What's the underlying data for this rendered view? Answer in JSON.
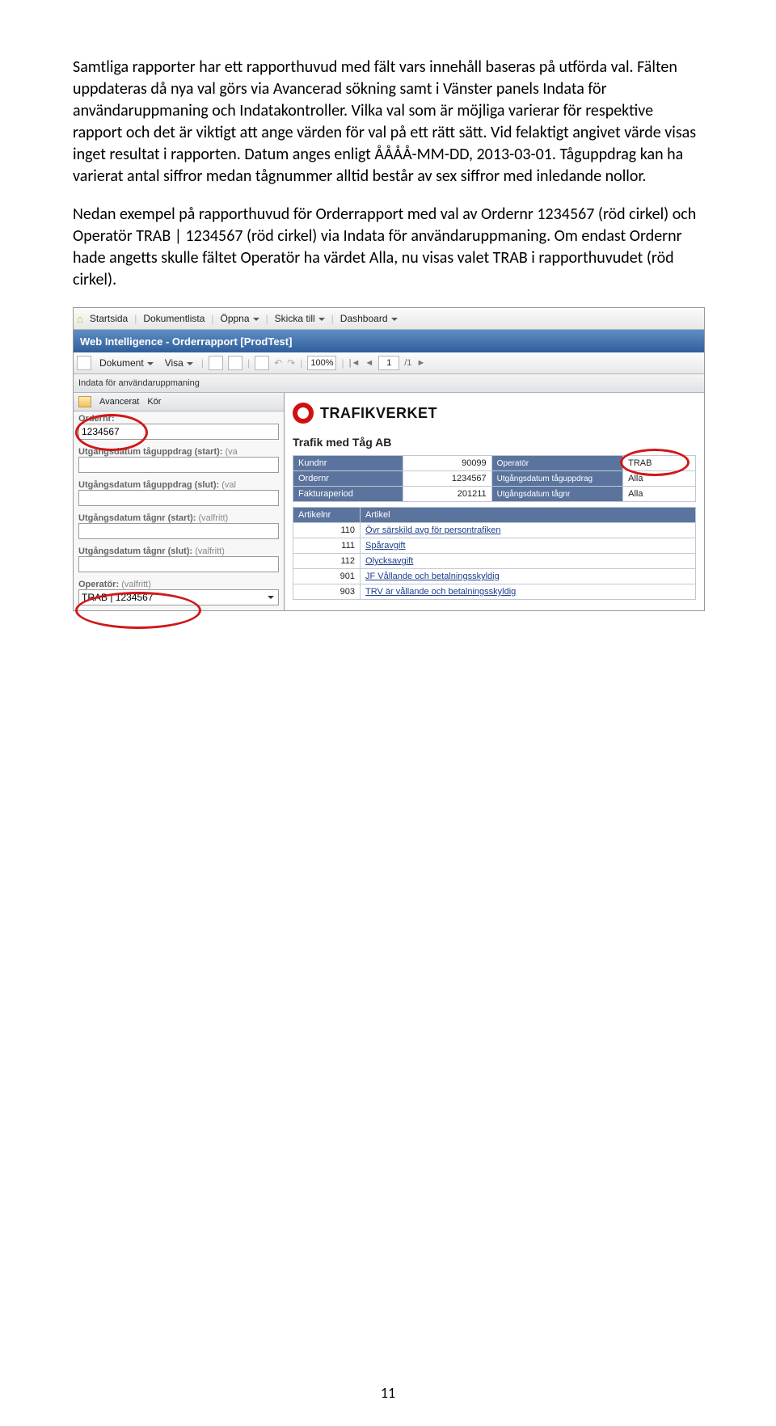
{
  "document": {
    "para1": "Samtliga rapporter har ett rapporthuvud med fält vars innehåll baseras på utförda val. Fälten uppdateras då nya val görs via Avancerad sökning samt i Vänster panels Indata för användaruppmaning och Indatakontroller. Vilka val som är möjliga varierar för respektive rapport och det är viktigt att ange värden för val på ett rätt sätt. Vid felaktigt angivet värde visas inget resultat i rapporten. Datum anges enligt ÅÅÅÅ-MM-DD, 2013-03-01. Tåguppdrag kan ha varierat antal siffror medan tågnummer alltid består av sex siffror med inledande nollor.",
    "para2": "Nedan exempel på rapporthuvud för Orderrapport med val av Ordernr 1234567 (röd cirkel) och Operatör TRAB | 1234567 (röd cirkel) via Indata för användaruppmaning. Om endast Ordernr hade angetts skulle fältet Operatör ha värdet Alla, nu visas valet TRAB i rapporthuvudet (röd cirkel).",
    "pageNumber": "11"
  },
  "app": {
    "tabs": {
      "start": "Startsida",
      "doclist": "Dokumentlista",
      "open": "Öppna",
      "send": "Skicka till",
      "dash": "Dashboard"
    },
    "title": "Web Intelligence - Orderrapport [ProdTest]",
    "toolbar": {
      "doc": "Dokument",
      "visa": "Visa",
      "zoom": "100%",
      "page": "1",
      "pageTotal": "/1"
    },
    "panelHeader": "Indata för användaruppmaning",
    "sidebar": {
      "adv": "Avancerat",
      "run": "Kör",
      "fields": {
        "ordernr": {
          "label": "Ordernr:",
          "value": "1234567"
        },
        "ut_start": {
          "label": "Utgångsdatum tåguppdrag (start):",
          "opt": "(va"
        },
        "ut_slut": {
          "label": "Utgångsdatum tåguppdrag (slut):",
          "opt": "(val"
        },
        "tn_start": {
          "label": "Utgångsdatum tågnr (start):",
          "opt": "(valfritt)"
        },
        "tn_slut": {
          "label": "Utgångsdatum tågnr (slut):",
          "opt": "(valfritt)"
        },
        "oper": {
          "label": "Operatör:",
          "opt": "(valfritt)",
          "value": "TRAB | 1234567"
        }
      }
    },
    "report": {
      "brand": "TRAFIKVERKET",
      "subtitle": "Trafik med Tåg AB",
      "header": {
        "kundnr_l": "Kundnr",
        "kundnr_v": "90099",
        "oper_l": "Operatör",
        "oper_v": "TRAB",
        "ordernr_l": "Ordernr",
        "ordernr_v": "1234567",
        "utu_l": "Utgångsdatum tåguppdrag",
        "utu_v": "Alla",
        "fakt_l": "Fakturaperiod",
        "fakt_v": "201211",
        "utt_l": "Utgångsdatum tågnr",
        "utt_v": "Alla"
      },
      "articles": {
        "h1": "Artikelnr",
        "h2": "Artikel",
        "rows": [
          {
            "n": "110",
            "t": "Övr särskild avg för persontrafiken"
          },
          {
            "n": "111",
            "t": "Spåravgift"
          },
          {
            "n": "112",
            "t": "Olycksavgift"
          },
          {
            "n": "901",
            "t": "JF Vållande och betalningsskyldig"
          },
          {
            "n": "903",
            "t": "TRV är vållande och betalningsskyldig"
          }
        ]
      }
    }
  }
}
